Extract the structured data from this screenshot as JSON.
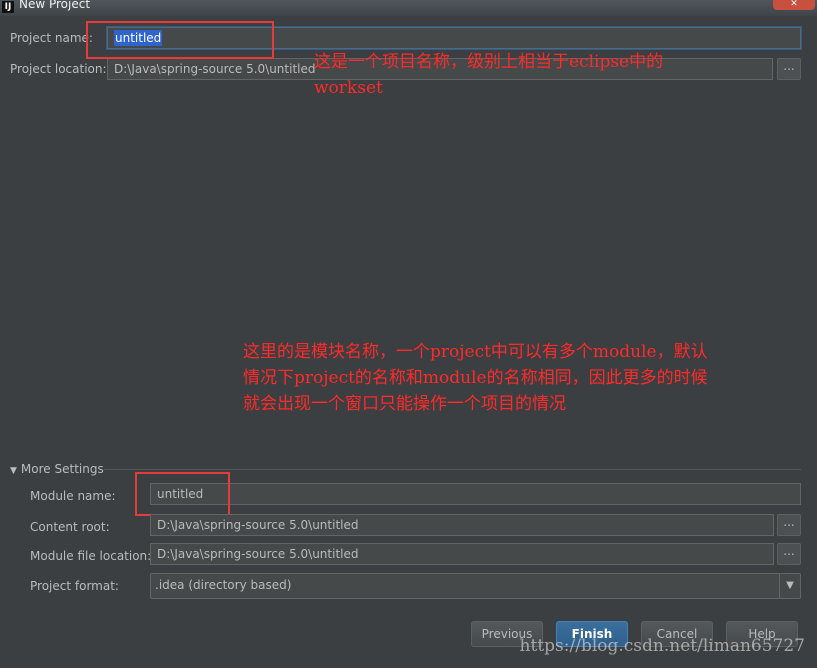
{
  "window": {
    "title": "New Project",
    "app_icon": "IJ",
    "close_glyph": "✕"
  },
  "project": {
    "name_label": "Project name:",
    "name_value": "untitled",
    "location_label": "Project location:",
    "location_value": "D:\\Java\\spring-source 5.0\\untitled",
    "browse_glyph": "..."
  },
  "annotations": {
    "top_line1": "这是一个项目名称，级别上相当于eclipse中的",
    "top_line2": "workset",
    "middle_line1": "这里的是模块名称，一个project中可以有多个module，默认",
    "middle_line2": "情况下project的名称和module的名称相同，因此更多的时候",
    "middle_line3": "就会出现一个窗口只能操作一个项目的情况"
  },
  "more_settings": {
    "title": "More Settings",
    "module_name_label": "Module name:",
    "module_name_value": "untitled",
    "content_root_label": "Content root:",
    "content_root_value": "D:\\Java\\spring-source 5.0\\untitled",
    "module_file_label": "Module file location:",
    "module_file_value": "D:\\Java\\spring-source 5.0\\untitled",
    "format_label": "Project format:",
    "format_value": ".idea (directory based)"
  },
  "buttons": {
    "previous": "Previous",
    "finish": "Finish",
    "cancel": "Cancel",
    "help": "Help"
  },
  "watermark": "https://blog.csdn.net/liman65727",
  "icons": {
    "collapse": "triangle-down-icon",
    "dropdown": "chevron-down-icon"
  },
  "colors": {
    "background": "#3c3f41",
    "annotation": "#ff2a2a",
    "selection": "#2f65ca",
    "primary_button": "#2f5f8c"
  }
}
